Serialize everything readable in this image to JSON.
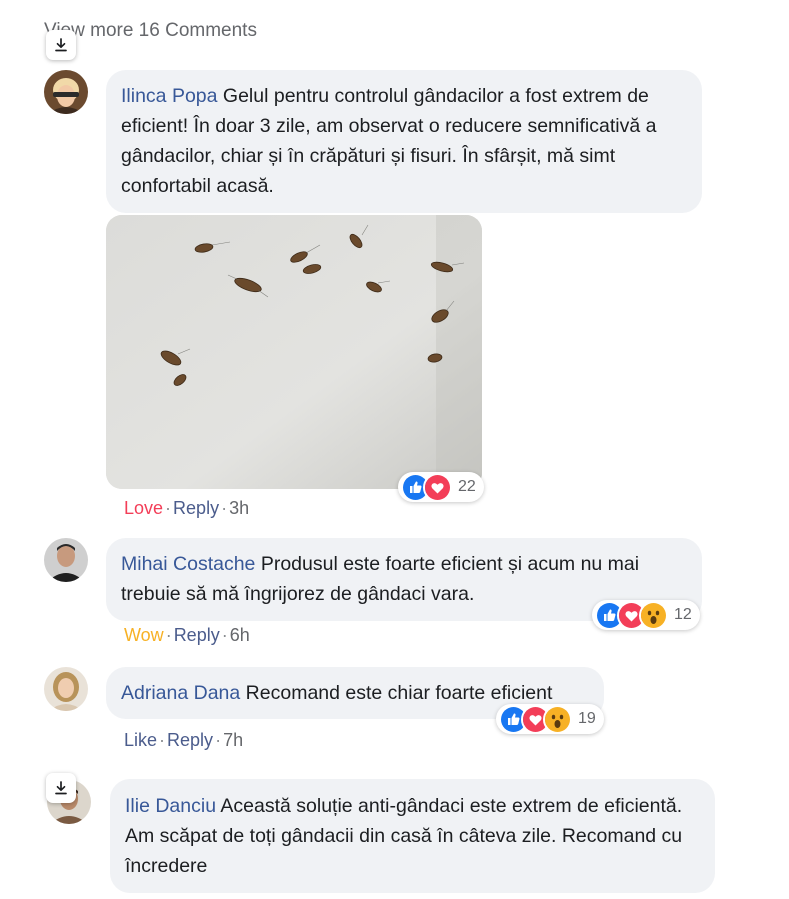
{
  "view_more": "View more 16 Comments",
  "download_icon": "download-icon",
  "comments": [
    {
      "author": "Ilinca Popa",
      "text": "Gelul pentru controlul gândacilor a fost extrem de eficient! În doar 3 zile, am observat o reducere semnificativă a gândacilor, chiar și în crăpături și fisuri. În sfârșit, mă simt confortabil acasă.",
      "reaction_label": "Love",
      "reply_label": "Reply",
      "time": "3h",
      "reaction_count": "22",
      "reaction_icons": [
        "like-icon",
        "love-icon"
      ],
      "label_color": "#f33e58",
      "has_photo": true
    },
    {
      "author": "Mihai Costache",
      "text": "Produsul este foarte eficient și acum nu mai trebuie să mă îngrijorez de gândaci vara.",
      "reaction_label": "Wow",
      "reply_label": "Reply",
      "time": "6h",
      "reaction_count": "12",
      "reaction_icons": [
        "like-icon",
        "love-icon",
        "wow-icon"
      ],
      "label_color": "#f7b125"
    },
    {
      "author": "Adriana Dana",
      "text": "Recomand este chiar foarte eficient",
      "reaction_label": "Like",
      "reply_label": "Reply",
      "time": "7h",
      "reaction_count": "19",
      "reaction_icons": [
        "like-icon",
        "love-icon",
        "wow-icon"
      ],
      "label_color": "#4b5c8c"
    },
    {
      "author": "Ilie Danciu",
      "text": "Această soluție anti-gândaci este extrem de eficientă. Am scăpat de toți gândacii din casă în câteva zile. Recomand cu încredere"
    }
  ],
  "colors": {
    "bubble": "#f0f2f5",
    "name": "#385898",
    "like_blue": "#1877f2",
    "love_red": "#f33e58",
    "wow_yellow": "#f7b125"
  }
}
